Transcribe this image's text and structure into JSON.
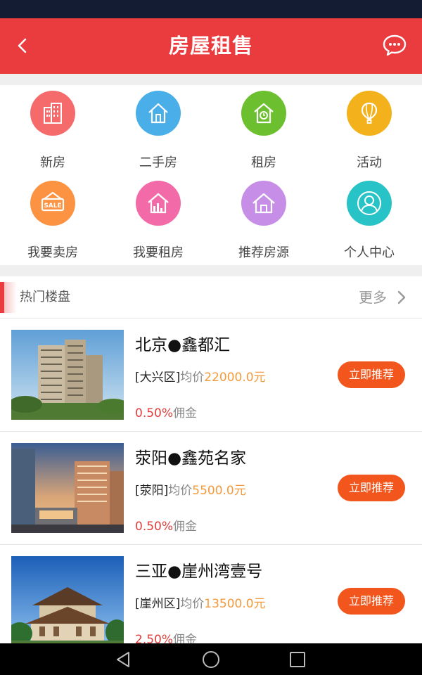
{
  "header": {
    "title": "房屋租售",
    "back_icon": "chevron-left-icon",
    "chat_icon": "chat-bubble-icon"
  },
  "categories": [
    {
      "label": "新房",
      "icon": "buildings-icon",
      "color": "#f56a6a"
    },
    {
      "label": "二手房",
      "icon": "house-icon",
      "color": "#4aaee8"
    },
    {
      "label": "租房",
      "icon": "house-clock-icon",
      "color": "#6cc02f"
    },
    {
      "label": "活动",
      "icon": "balloon-icon",
      "color": "#f3b11b"
    },
    {
      "label": "我要卖房",
      "icon": "sale-sign-icon",
      "color": "#fb9342"
    },
    {
      "label": "我要租房",
      "icon": "house-chart-icon",
      "color": "#f36aa8"
    },
    {
      "label": "推荐房源",
      "icon": "house-outline-icon",
      "color": "#c78ee8"
    },
    {
      "label": "个人中心",
      "icon": "user-icon",
      "color": "#27c3c6"
    }
  ],
  "section": {
    "title": "热门楼盘",
    "more": "更多"
  },
  "listings": [
    {
      "name": "北京●鑫都汇",
      "district": "[大兴区]",
      "avg_label": "均价",
      "price": "22000.0元",
      "commission_rate": "0.50%",
      "commission_label": "佣金",
      "button": "立即推荐"
    },
    {
      "name": "荥阳●鑫苑名家",
      "district": "[荥阳]",
      "avg_label": "均价",
      "price": "5500.0元",
      "commission_rate": "0.50%",
      "commission_label": "佣金",
      "button": "立即推荐"
    },
    {
      "name": "三亚●崖州湾壹号",
      "district": "[崖州区]",
      "avg_label": "均价",
      "price": "13500.0元",
      "commission_rate": "2.50%",
      "commission_label": "佣金",
      "button": "立即推荐"
    }
  ],
  "colors": {
    "brand": "#ea3b3e",
    "accent_button": "#f2561d",
    "price": "#f39a3c",
    "commission": "#e23b3b"
  }
}
